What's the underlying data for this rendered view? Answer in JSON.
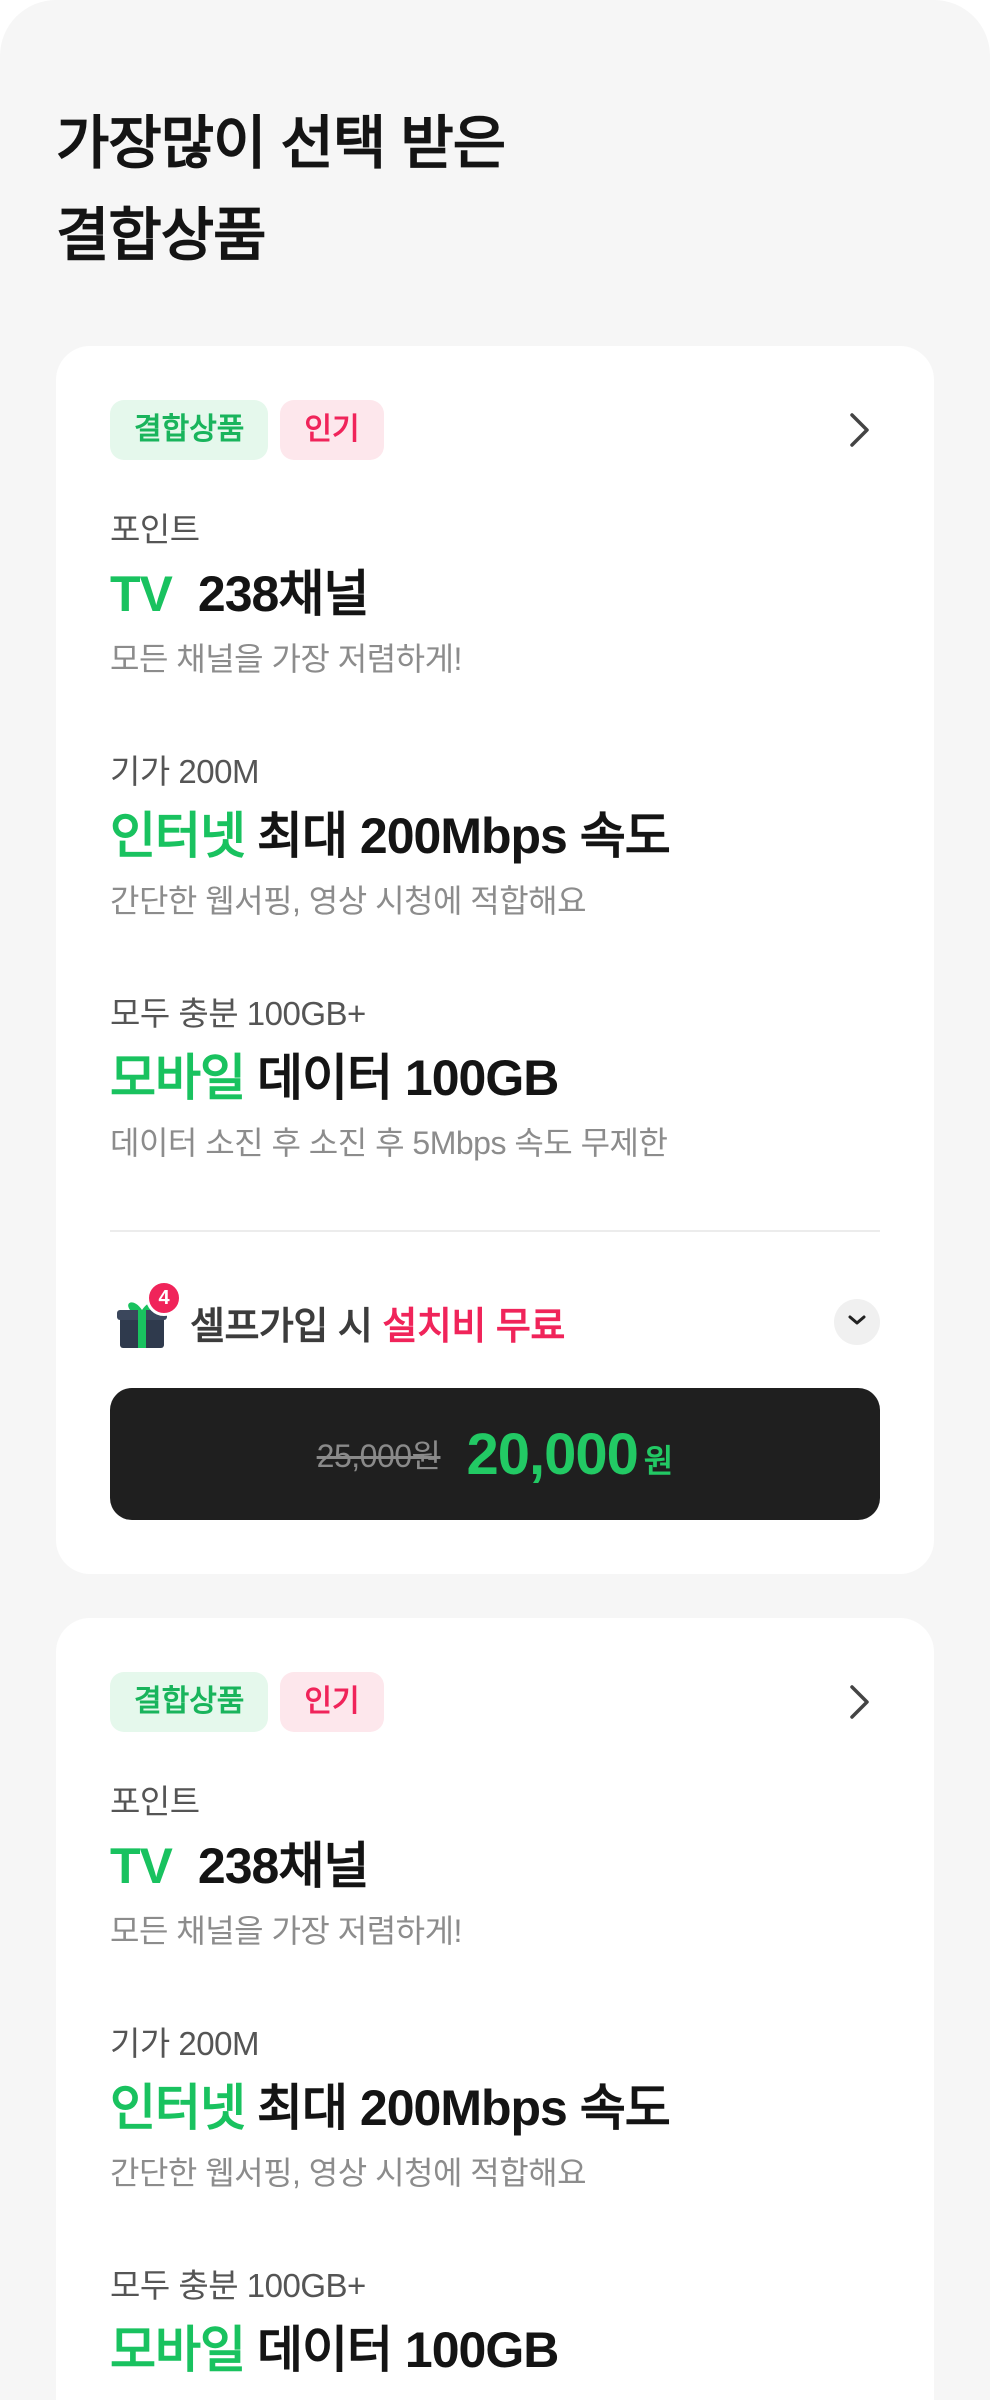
{
  "page": {
    "title_line1": "가장많이 선택 받은",
    "title_line2": "결합상품"
  },
  "cards": [
    {
      "tags": [
        "결합상품",
        "인기"
      ],
      "features": [
        {
          "label": "포인트",
          "accent": "TV",
          "title": "238채널",
          "desc": "모든 채널을 가장 저렴하게!"
        },
        {
          "label": "기가 200M",
          "accent": "인터넷",
          "title": "최대 200Mbps 속도",
          "desc": "간단한 웹서핑, 영상 시청에 적합해요"
        },
        {
          "label": "모두 충분 100GB+",
          "accent": "모바일",
          "title": "데이터 100GB",
          "desc": "데이터 소진 후 소진 후 5Mbps 속도 무제한"
        }
      ],
      "promo": {
        "badge": "4",
        "text": "셀프가입 시",
        "highlight": "설치비 무료"
      },
      "price": {
        "original": "25,000원",
        "current": "20,000",
        "currency": "원"
      }
    },
    {
      "tags": [
        "결합상품",
        "인기"
      ],
      "features": [
        {
          "label": "포인트",
          "accent": "TV",
          "title": "238채널",
          "desc": "모든 채널을 가장 저렴하게!"
        },
        {
          "label": "기가 200M",
          "accent": "인터넷",
          "title": "최대 200Mbps 속도",
          "desc": "간단한 웹서핑, 영상 시청에 적합해요"
        },
        {
          "label": "모두 충분 100GB+",
          "accent": "모바일",
          "title": "데이터 100GB"
        }
      ]
    }
  ],
  "colors": {
    "accent_green": "#19c25f",
    "accent_red": "#f0245a",
    "price_bar": "#1f1f1f",
    "background": "#f6f6f6"
  },
  "icons": {
    "more": "chevron-right-icon",
    "promo": "gift-icon",
    "expand": "chevron-down-icon"
  }
}
